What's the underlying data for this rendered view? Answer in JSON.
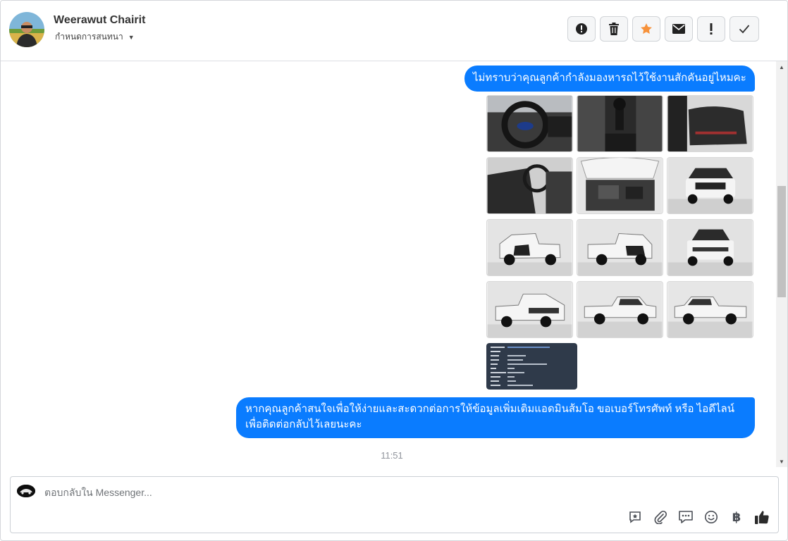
{
  "header": {
    "contact_name": "Weerawut Chairit",
    "subtitle": "กำหนดการสนทนา",
    "actions": [
      {
        "name": "report-spam-button",
        "icon": "alert-circle-icon"
      },
      {
        "name": "delete-button",
        "icon": "trash-icon"
      },
      {
        "name": "star-button",
        "icon": "star-icon",
        "color": "#f7923b"
      },
      {
        "name": "mark-unread-button",
        "icon": "envelope-icon"
      },
      {
        "name": "mark-important-button",
        "icon": "exclamation-icon"
      },
      {
        "name": "mark-done-button",
        "icon": "check-icon"
      }
    ]
  },
  "messages": [
    {
      "type": "text",
      "text": "ไม่ทราบว่าคุณลูกค้ากำลังมองหารถไว้ใช้งานสักคันอยู่ไหมคะ"
    },
    {
      "type": "images",
      "count": 13
    },
    {
      "type": "text",
      "text": "หากคุณลูกค้าสนใจเพื่อให้ง่ายและสะดวกต่อการให้ข้อมูลเพิ่มเติมแอดมินส้มโอ ขอเบอร์โทรศัพท์ หรือ ไอดีไลน์ เพื่อติดต่อกลับไว้เลยนะคะ"
    }
  ],
  "timestamp": "11:51",
  "composer": {
    "placeholder": "ตอบกลับใน Messenger...",
    "tools": [
      "saved-reply-icon",
      "paperclip-icon",
      "chat-bubble-icon",
      "emoji-icon",
      "baht-icon",
      "thumbs-up-icon"
    ],
    "baht_symbol": "฿"
  },
  "colors": {
    "bubble": "#0a7cff",
    "star": "#f7923b",
    "timestamp": "#90949c"
  }
}
